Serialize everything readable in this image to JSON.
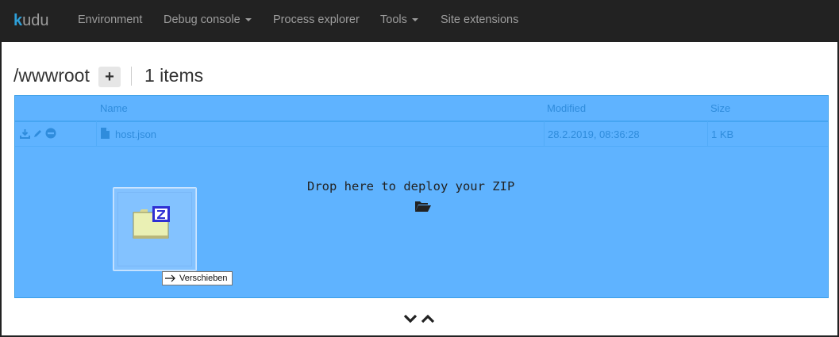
{
  "navbar": {
    "brand": "udu",
    "brand_k": "k",
    "items": [
      {
        "label": "Environment",
        "dropdown": false
      },
      {
        "label": "Debug console",
        "dropdown": true
      },
      {
        "label": "Process explorer",
        "dropdown": false
      },
      {
        "label": "Tools",
        "dropdown": true
      },
      {
        "label": "Site extensions",
        "dropdown": false
      }
    ]
  },
  "header": {
    "path": "/wwwroot",
    "add_label": "+",
    "items_count": "1 items"
  },
  "table": {
    "columns": [
      "Name",
      "Modified",
      "Size"
    ],
    "rows": [
      {
        "name": "host.json",
        "modified": "28.2.2019, 08:36:28",
        "size": "1 KB"
      }
    ]
  },
  "dropzone": {
    "text": "Drop here to deploy your ZIP"
  },
  "drag": {
    "tooltip": "Verschieben"
  },
  "colors": {
    "navbar_bg": "#222222",
    "dropzone_bg": "#5fb3ff",
    "brand_accent": "#2e9fd8"
  }
}
